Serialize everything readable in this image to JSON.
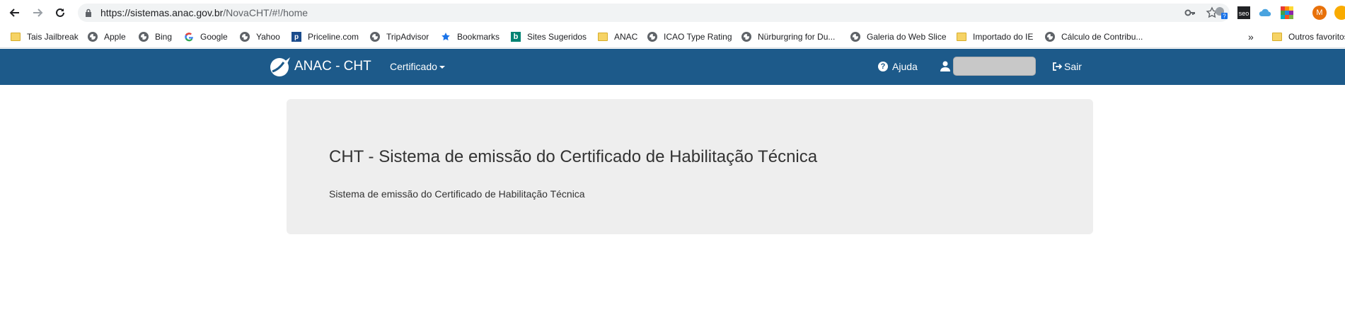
{
  "browser": {
    "url_host": "https://sistemas.anac.gov.br",
    "url_path": "/NovaCHT/#!/home",
    "profile_initial": "M"
  },
  "bookmarks": {
    "items": [
      {
        "label": "Tais Jailbreak",
        "icon": "folder-icon"
      },
      {
        "label": "Apple",
        "icon": "globe-icon"
      },
      {
        "label": "Bing",
        "icon": "globe-icon"
      },
      {
        "label": "Google",
        "icon": "google-icon"
      },
      {
        "label": "Yahoo",
        "icon": "globe-icon"
      },
      {
        "label": "Priceline.com",
        "icon": "priceline-icon"
      },
      {
        "label": "TripAdvisor",
        "icon": "globe-icon"
      },
      {
        "label": "Bookmarks",
        "icon": "star-icon"
      },
      {
        "label": "Sites Sugeridos",
        "icon": "bing-icon"
      },
      {
        "label": "ANAC",
        "icon": "folder-icon"
      },
      {
        "label": "ICAO Type Rating",
        "icon": "globe-icon"
      },
      {
        "label": "Nürburgring for Du...",
        "icon": "globe-icon"
      },
      {
        "label": "Galeria do Web Slice",
        "icon": "globe-icon"
      },
      {
        "label": "Importado do IE",
        "icon": "folder-icon"
      },
      {
        "label": "Cálculo de Contribu...",
        "icon": "globe-icon"
      }
    ],
    "overflow": "»",
    "other": "Outros favoritos"
  },
  "site": {
    "brand": "ANAC - CHT",
    "menu_certificado": "Certificado",
    "help": "Ajuda",
    "logout": "Sair",
    "accent": "#1d5a8a"
  },
  "main": {
    "title": "CHT - Sistema de emissão do Certificado de Habilitação Técnica",
    "subtitle": "Sistema de emissão do Certificado de Habilitação Técnica"
  }
}
